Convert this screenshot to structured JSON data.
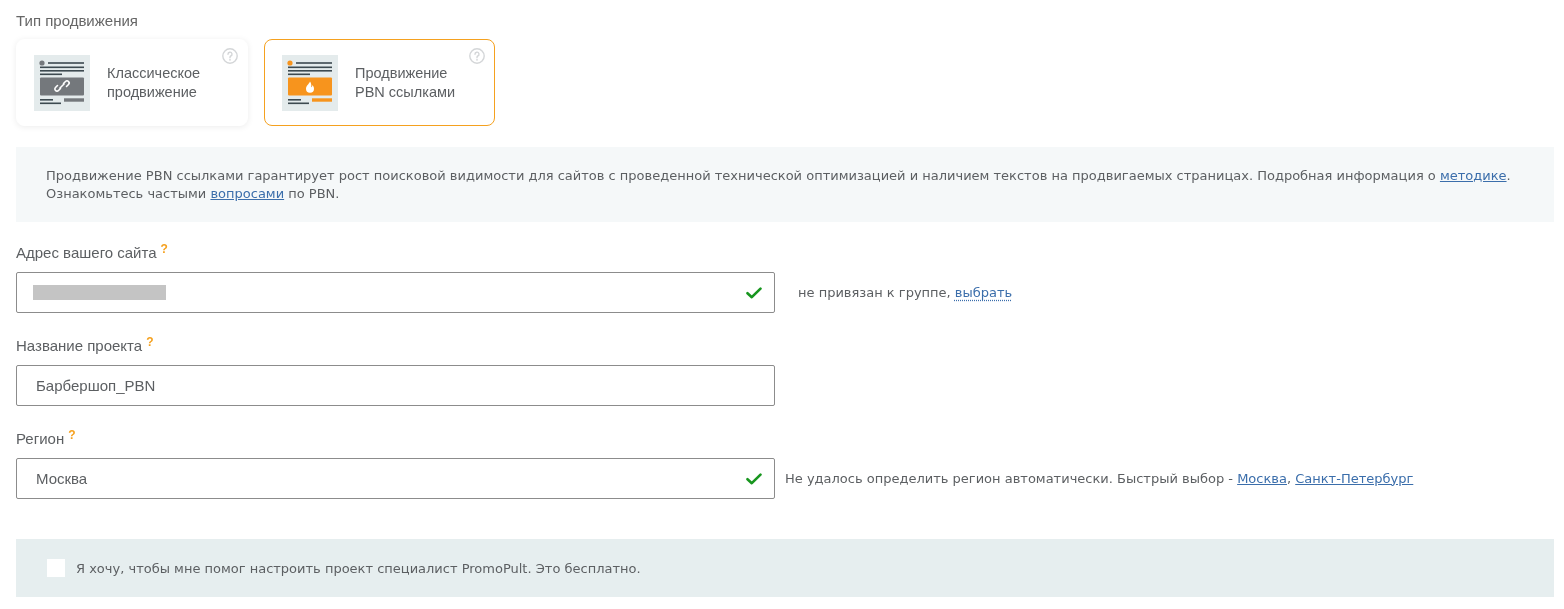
{
  "section_title": "Тип продвижения",
  "promotion_types": [
    {
      "kind": "classic",
      "label": "Классическое продвижение",
      "selected": false
    },
    {
      "kind": "pbn",
      "label": "Продвижение PBN ссылками",
      "selected": true
    }
  ],
  "info": {
    "lines": [
      [
        {
          "kind": "text",
          "text": "Продвижение PBN ссылками гарантирует рост поисковой видимости для сайтов с проведенной технической оптимизацией и наличием текстов на продвигаемых страницах. Подробная информация о "
        },
        {
          "kind": "link",
          "text": "методике"
        },
        {
          "kind": "text",
          "text": "."
        }
      ],
      [
        {
          "kind": "text",
          "text": "Ознакомьтесь частыми "
        },
        {
          "kind": "link",
          "text": "вопросами"
        },
        {
          "kind": "text",
          "text": " по PBN."
        }
      ]
    ]
  },
  "fields": [
    {
      "label": "Адрес вашего сайта",
      "help": "?",
      "redacted": true,
      "valid": true,
      "note": [
        {
          "kind": "text",
          "text": "не привязан к группе, "
        },
        {
          "kind": "action",
          "text": "выбрать"
        }
      ]
    },
    {
      "label": "Название проекта",
      "help": "?",
      "redacted": false,
      "value": "Барбершоп_PBN",
      "valid": false
    },
    {
      "label": "Регион",
      "help": "?",
      "redacted": false,
      "value": "Москва",
      "valid": true,
      "note": [
        {
          "kind": "text",
          "text": "Не удалось определить регион автоматически. Быстрый выбор - "
        },
        {
          "kind": "link",
          "text": "Москва"
        },
        {
          "kind": "text",
          "text": ", "
        },
        {
          "kind": "link",
          "text": "Санкт-Петербург"
        }
      ]
    }
  ],
  "consult": {
    "checked": false,
    "label": "Я хочу, чтобы мне помог настроить проект специалист PromoPult. Это бесплатно."
  }
}
